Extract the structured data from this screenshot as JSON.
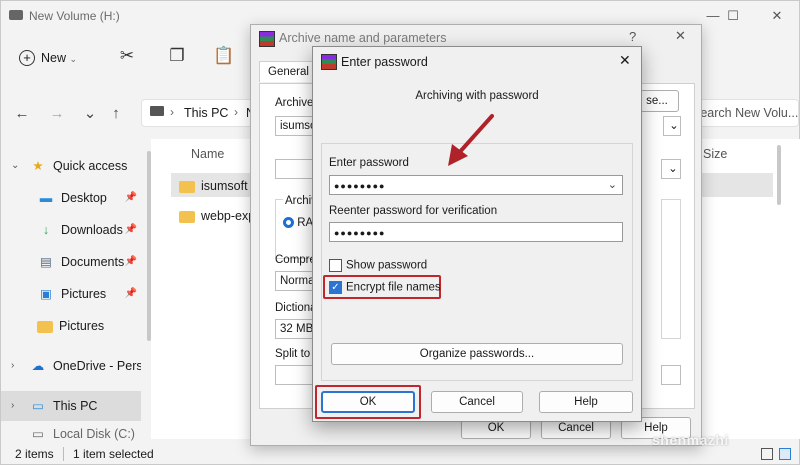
{
  "explorer": {
    "title": "New Volume (H:)",
    "toolbar": {
      "new_label": "New"
    },
    "breadcrumb": {
      "root_icon": "pc-icon",
      "item1": "This PC",
      "item2_partial": "N"
    },
    "search_placeholder": "Search New Volu...",
    "sidebar": [
      {
        "label": "Quick access",
        "icon": "star-icon",
        "expanded": true
      },
      {
        "label": "Desktop",
        "icon": "desktop-icon",
        "pinned": true
      },
      {
        "label": "Downloads",
        "icon": "download-icon",
        "pinned": true
      },
      {
        "label": "Documents",
        "icon": "document-icon",
        "pinned": true
      },
      {
        "label": "Pictures",
        "icon": "picture-icon",
        "pinned": true
      },
      {
        "label": "Pictures",
        "icon": "folder-icon",
        "pinned": false
      },
      {
        "label": "OneDrive - Perso",
        "icon": "cloud-icon"
      },
      {
        "label": "This PC",
        "icon": "pc-icon",
        "selected": true
      },
      {
        "label": "Local Disk (C:)",
        "icon": "drive-icon"
      }
    ],
    "columns": {
      "name": "Name",
      "size": "Size"
    },
    "files": [
      {
        "name": "isumsoft",
        "selected": true
      },
      {
        "name": "webp-exp"
      }
    ],
    "status": {
      "items": "2 items",
      "selected": "1 item selected"
    }
  },
  "archive_dialog": {
    "title": "Archive name and parameters",
    "help_glyph": "?",
    "tab_general": "General",
    "archive_name_label": "Archive",
    "archive_name_value": "isumsoft",
    "browse_label": "Browse...",
    "browse_partial": "se...",
    "format_label": "Archive",
    "format_rar": "RAR",
    "compression_label": "Compre",
    "compression_value": "Normal",
    "dictionary_label": "Dictiona",
    "dictionary_value": "32 MB",
    "split_label": "Split to",
    "ok": "OK",
    "cancel": "Cancel",
    "help": "Help"
  },
  "password_dialog": {
    "title": "Enter password",
    "heading": "Archiving with password",
    "enter_label": "Enter password",
    "enter_value": "●●●●●●●●",
    "reenter_label": "Reenter password for verification",
    "reenter_value": "●●●●●●●●",
    "show_password": "Show password",
    "show_password_checked": false,
    "encrypt_names": "Encrypt file names",
    "encrypt_names_checked": true,
    "organize": "Organize passwords...",
    "ok": "OK",
    "cancel": "Cancel",
    "help": "Help"
  },
  "watermark": "shenmazhi",
  "accent_color": "#c0262c"
}
